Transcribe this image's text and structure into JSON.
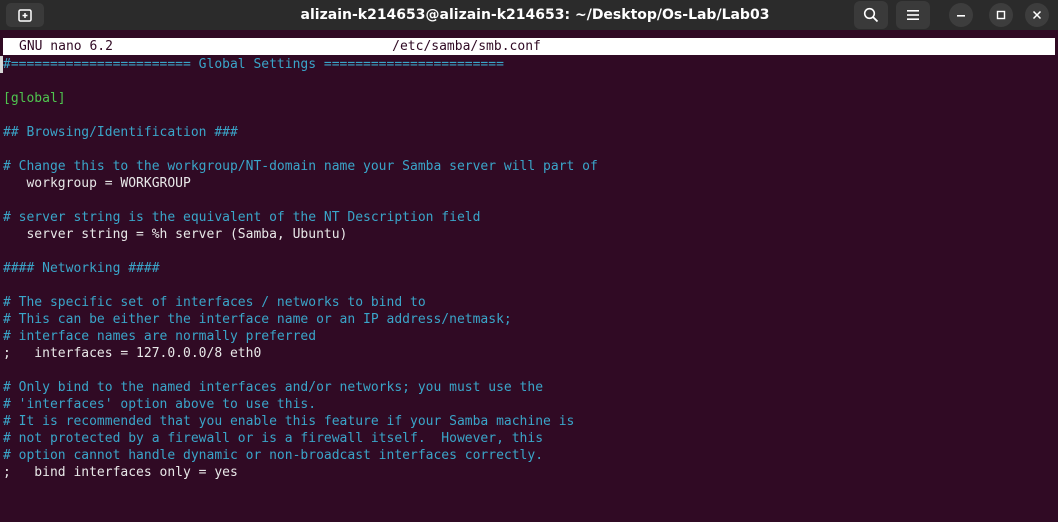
{
  "window": {
    "title": "alizain-k214653@alizain-k214653: ~/Desktop/Os-Lab/Lab03",
    "buttons": {
      "new_tab_icon": "new-tab-icon",
      "search_icon": "search-icon",
      "menu_icon": "hamburger-menu-icon",
      "minimize_icon": "minimize-icon",
      "maximize_icon": "maximize-icon",
      "close_icon": "close-icon"
    }
  },
  "nano": {
    "version_label": "GNU nano 6.2",
    "filename": "/etc/samba/smb.conf"
  },
  "lines": [
    {
      "text": "#======================= Global Settings =======================",
      "kind": "comment"
    },
    {
      "text": "",
      "kind": "blank"
    },
    {
      "text": "[global]",
      "kind": "section"
    },
    {
      "text": "",
      "kind": "blank"
    },
    {
      "text": "## Browsing/Identification ###",
      "kind": "comment"
    },
    {
      "text": "",
      "kind": "blank"
    },
    {
      "text": "# Change this to the workgroup/NT-domain name your Samba server will part of",
      "kind": "comment"
    },
    {
      "text": "   workgroup = WORKGROUP",
      "kind": "setting"
    },
    {
      "text": "",
      "kind": "blank"
    },
    {
      "text": "# server string is the equivalent of the NT Description field",
      "kind": "comment"
    },
    {
      "text": "   server string = %h server (Samba, Ubuntu)",
      "kind": "setting"
    },
    {
      "text": "",
      "kind": "blank"
    },
    {
      "text": "#### Networking ####",
      "kind": "comment"
    },
    {
      "text": "",
      "kind": "blank"
    },
    {
      "text": "# The specific set of interfaces / networks to bind to",
      "kind": "comment"
    },
    {
      "text": "# This can be either the interface name or an IP address/netmask;",
      "kind": "comment"
    },
    {
      "text": "# interface names are normally preferred",
      "kind": "comment"
    },
    {
      "text": ";   interfaces = 127.0.0.0/8 eth0",
      "kind": "setting"
    },
    {
      "text": "",
      "kind": "blank"
    },
    {
      "text": "# Only bind to the named interfaces and/or networks; you must use the",
      "kind": "comment"
    },
    {
      "text": "# 'interfaces' option above to use this.",
      "kind": "comment"
    },
    {
      "text": "# It is recommended that you enable this feature if your Samba machine is",
      "kind": "comment"
    },
    {
      "text": "# not protected by a firewall or is a firewall itself.  However, this",
      "kind": "comment"
    },
    {
      "text": "# option cannot handle dynamic or non-broadcast interfaces correctly.",
      "kind": "comment"
    },
    {
      "text": ";   bind interfaces only = yes",
      "kind": "setting"
    }
  ],
  "colors": {
    "terminal_bg": "#300a24",
    "comment": "#3aa5c9",
    "section": "#4fc44f",
    "text": "#e8e8e8"
  }
}
